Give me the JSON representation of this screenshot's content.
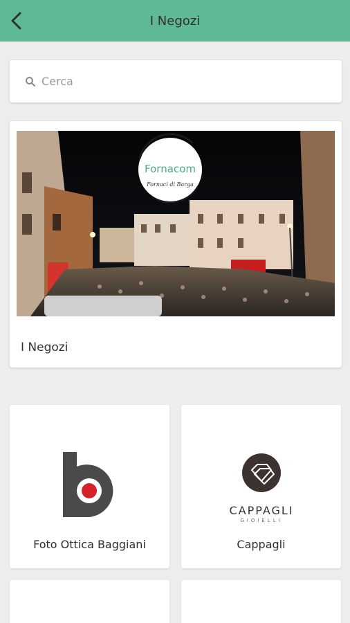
{
  "header": {
    "title": "I Negozi",
    "back_icon": "arrow-back-icon",
    "bg_color": "#5fb996"
  },
  "search": {
    "placeholder": "Cerca",
    "value": "",
    "icon": "search-icon"
  },
  "hero": {
    "logo_text": "Fornacom",
    "logo_subtext": "Fornaci di Barga",
    "title": "I Negozi"
  },
  "shops": [
    {
      "name": "Foto Ottica Baggiani",
      "logo": "baggiani-logo"
    },
    {
      "name": "Cappagli",
      "logo": "cappagli-logo",
      "logo_text": "CAPPAGLI",
      "logo_subtext": "GIOIELLI"
    },
    {
      "name": "",
      "logo": ""
    },
    {
      "name": "",
      "logo": ""
    }
  ]
}
